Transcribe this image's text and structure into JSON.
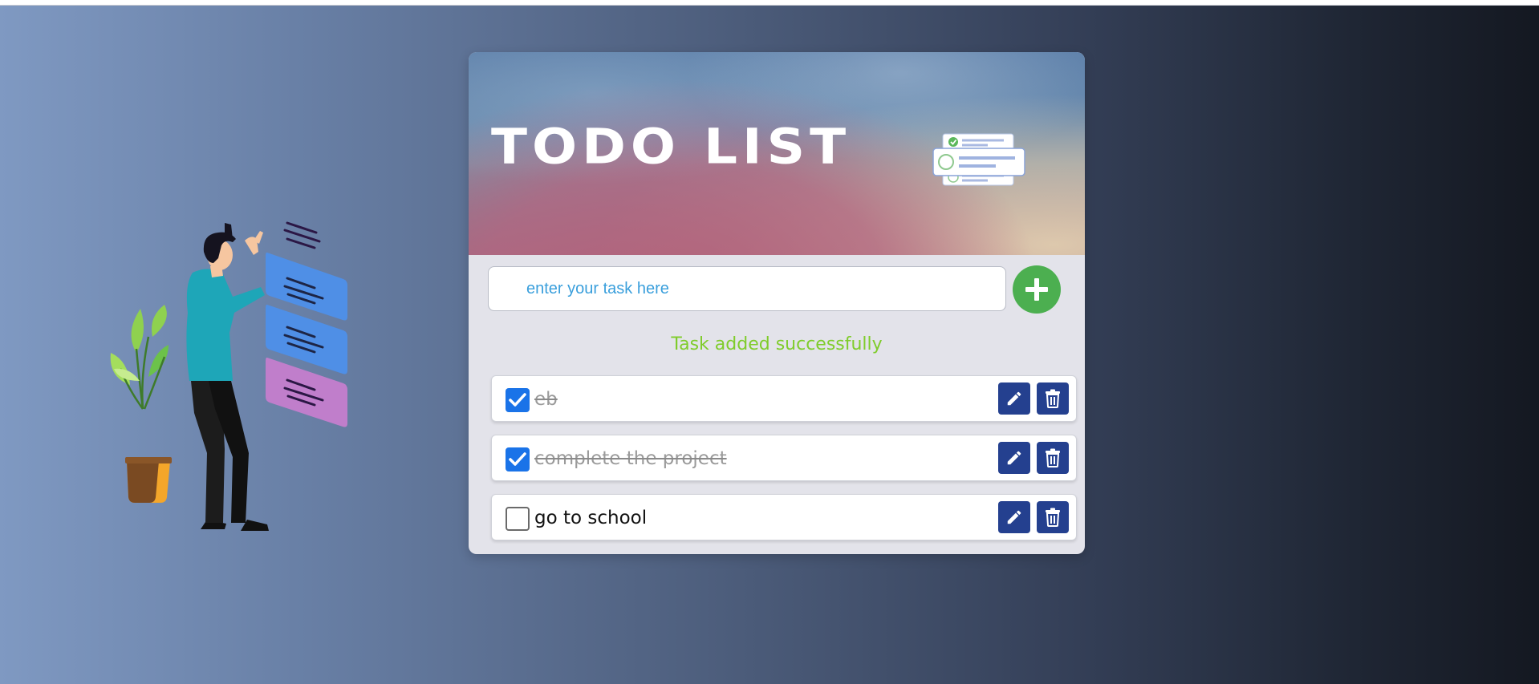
{
  "app": {
    "title": "TODO LIST"
  },
  "form": {
    "input_placeholder": "enter your task here",
    "input_value": "",
    "add_button_icon": "plus-icon"
  },
  "status": {
    "message": "Task added successfully"
  },
  "tasks": [
    {
      "text": "eb",
      "completed": true
    },
    {
      "text": "complete the project",
      "completed": true
    },
    {
      "text": "go to school",
      "completed": false
    }
  ],
  "icons": {
    "edit": "pencil-icon",
    "delete": "trash-icon",
    "check": "checkmark-icon"
  },
  "colors": {
    "accent_green": "#4caf50",
    "success_text": "#7fcc2b",
    "action_button": "#24408f",
    "checkbox_checked": "#1a73e8",
    "placeholder_text": "#3a9fdc"
  }
}
